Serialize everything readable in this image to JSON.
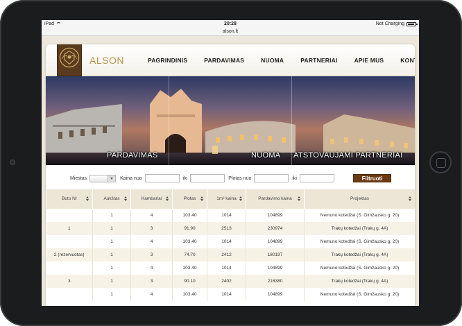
{
  "status": {
    "device": "iPad",
    "time": "20:28",
    "charging": "Not Charging"
  },
  "browser": {
    "url": "alson.lt"
  },
  "header": {
    "brand": "ALSON",
    "nav": [
      "PAGRINDINIS",
      "PARDAVIMAS",
      "NUOMA",
      "PARTNERIAI",
      "APIE MUS",
      "KONTAKTAI"
    ]
  },
  "banner": {
    "panels": [
      "PARDAVIMAS",
      "NUOMA",
      "ATSTOVAUJAMI PARTNERIAI"
    ]
  },
  "filters": {
    "city_label": "Miestas",
    "price_from_label": "Kaina nuo",
    "price_to_label": "iki",
    "area_from_label": "Plotas nuo",
    "area_to_label": "iki",
    "submit_label": "Filtruoti"
  },
  "table": {
    "headers": [
      "Buto Nr",
      "Aukštas",
      "Kambariai",
      "Plotas",
      "1m² kaina",
      "Pardavimo kaina",
      "Projektas"
    ],
    "rows": [
      [
        "",
        "1",
        "4",
        "103.40",
        "1014",
        "104899",
        "Nemuno kotedžai (S. Gimžausko g. 20)"
      ],
      [
        "1",
        "1",
        "3",
        "91.90",
        "2513",
        "230974",
        "Trakų kotedžai (Trakų g. 4A)"
      ],
      [
        "",
        "1",
        "4",
        "103.40",
        "1014",
        "104899",
        "Nemuno kotedžai (S. Gimžausko g. 20)"
      ],
      [
        "2 (rezervuotas)",
        "1",
        "3",
        "74.70",
        "2412",
        "180197",
        "Trakų kotedžai (Trakų g. 4A)"
      ],
      [
        "",
        "1",
        "4",
        "103.40",
        "1014",
        "104899",
        "Nemuno kotedžai (S. Gimžausko g. 20)"
      ],
      [
        "3",
        "1",
        "3",
        "90.10",
        "2402",
        "216380",
        "Trakų kotedžai (Trakų g. 4A)"
      ],
      [
        "",
        "1",
        "4",
        "103.40",
        "1014",
        "104899",
        "Nemuno kotedžai (S. Gimžausko g. 20)"
      ]
    ]
  },
  "colors": {
    "brand_gold": "#b6924a",
    "button_brown": "#6b3a12",
    "header_beige": "#ece6d6"
  }
}
